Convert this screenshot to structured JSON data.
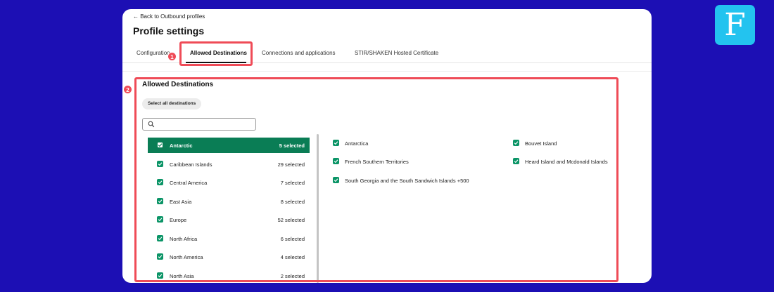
{
  "header": {
    "back_link": "← Back to Outbound profiles",
    "title": "Profile settings"
  },
  "tabs": [
    {
      "label": "Configuration"
    },
    {
      "label": "Allowed Destinations"
    },
    {
      "label": "Connections and applications"
    },
    {
      "label": "STIR/SHAKEN Hosted Certificate"
    }
  ],
  "section": {
    "title": "Allowed Destinations",
    "select_all_label": "Select all destinations",
    "search_value": "",
    "search_placeholder": ""
  },
  "regions": [
    {
      "name": "Antarctic",
      "count": "5 selected",
      "selected": true
    },
    {
      "name": "Caribbean Islands",
      "count": "29 selected"
    },
    {
      "name": "Central America",
      "count": "7 selected"
    },
    {
      "name": "East Asia",
      "count": "8 selected"
    },
    {
      "name": "Europe",
      "count": "52 selected"
    },
    {
      "name": "North Africa",
      "count": "6 selected"
    },
    {
      "name": "North America",
      "count": "4 selected"
    },
    {
      "name": "North Asia",
      "count": "2 selected"
    }
  ],
  "countries": [
    {
      "name": "Antarctica"
    },
    {
      "name": "Bouvet Island"
    },
    {
      "name": "French Southern Territories"
    },
    {
      "name": "Heard Island and Mcdonald Islands"
    },
    {
      "name": "South Georgia and the South Sandwich Islands +500"
    }
  ],
  "annotations": {
    "badge_1": "1",
    "badge_2": "2"
  },
  "logo": {
    "letter": "F"
  },
  "colors": {
    "background": "#1c0fb4",
    "accent_green": "#0a7d55",
    "checkbox_green": "#0a9466",
    "highlight_red": "#ef4b57",
    "logo_blue": "#23c3ef"
  }
}
